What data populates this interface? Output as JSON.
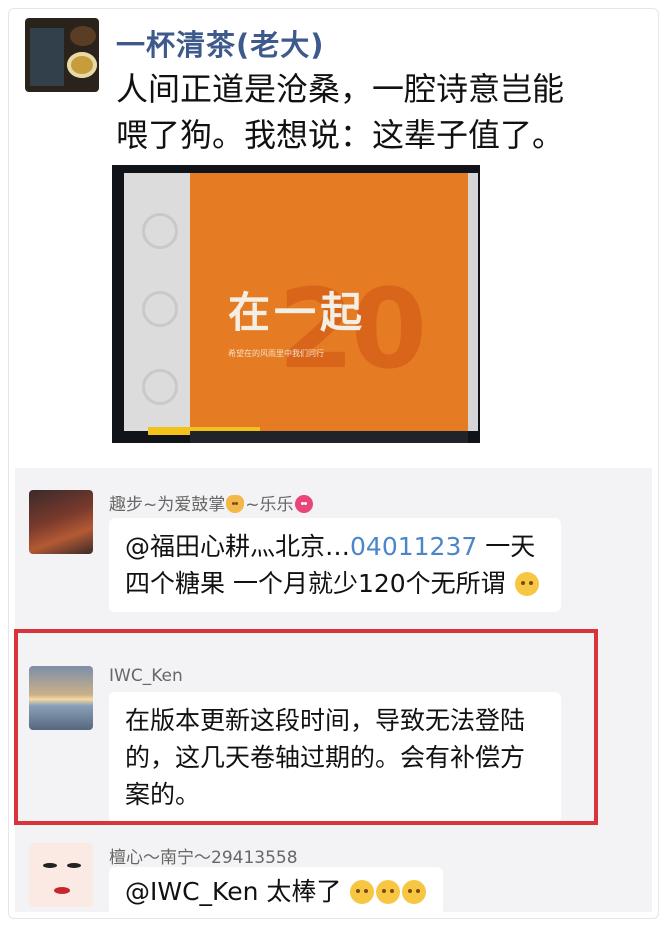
{
  "post": {
    "author": "一杯清茶(老大)",
    "text_line1": "人间正道是沧桑，一腔诗意岂能",
    "text_line2": "喂了狗。我想说：这辈子值了。",
    "image": {
      "headline": "在一起",
      "subtext": "希望在的风雨里中我们同行"
    }
  },
  "comments": [
    {
      "name": "趣步~为爱鼓掌",
      "name_suffix": "~乐乐",
      "name_emojis": [
        "clap-emoji",
        "two-hearts-emoji"
      ],
      "text_prefix": "@福田心耕灬北京…",
      "text_number": "04011237",
      "text_rest": " 一天四个糖果 一个月就少120个无所谓",
      "text_emoji": "pleading-face-emoji"
    },
    {
      "name": "IWC_Ken",
      "text": "在版本更新这段时间，导致无法登陆的，这几天卷轴过期的。会有补偿方案的。",
      "highlighted": true
    },
    {
      "name": "檀心～南宁～29413558",
      "text": "@IWC_Ken 太棒了",
      "text_emojis": [
        "hugging-face-emoji",
        "hugging-face-emoji",
        "hugging-face-emoji"
      ]
    }
  ],
  "colors": {
    "author_name": "#3e5a8c",
    "highlight_border": "#d9343c",
    "comment_bg": "#f3f3f5",
    "number_link": "#4a86c9"
  }
}
